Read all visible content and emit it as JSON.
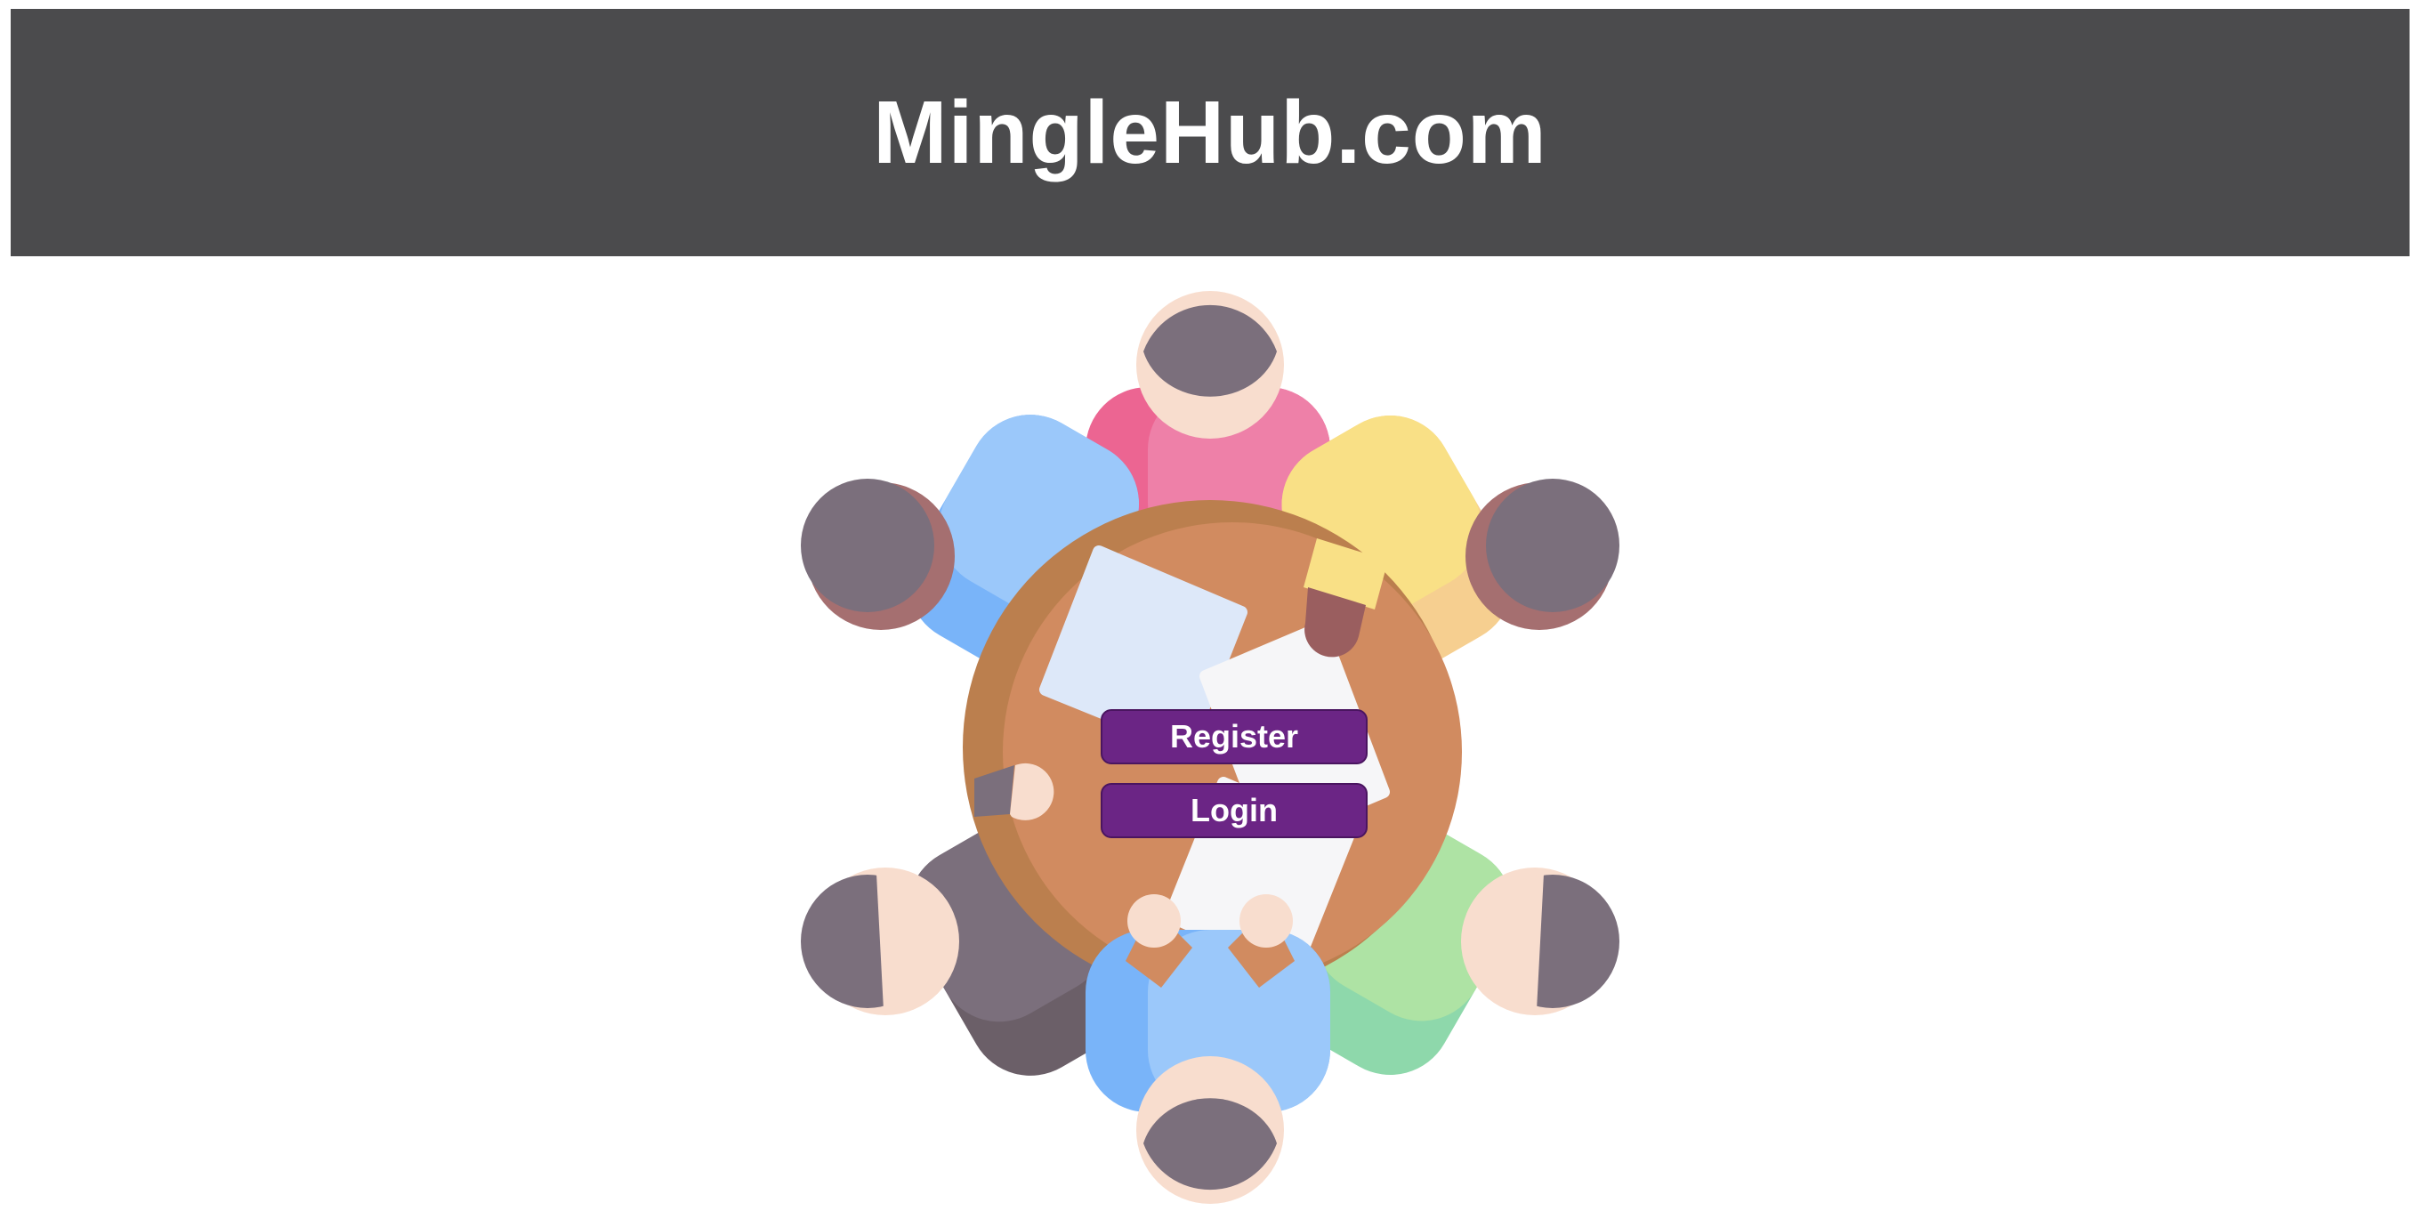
{
  "header": {
    "title": "MingleHub.com",
    "background_color": "#4b4b4d"
  },
  "hero": {
    "illustration_icon": "people-around-table-icon"
  },
  "actions": {
    "register_label": "Register",
    "login_label": "Login",
    "button_color": "#6b2585"
  }
}
